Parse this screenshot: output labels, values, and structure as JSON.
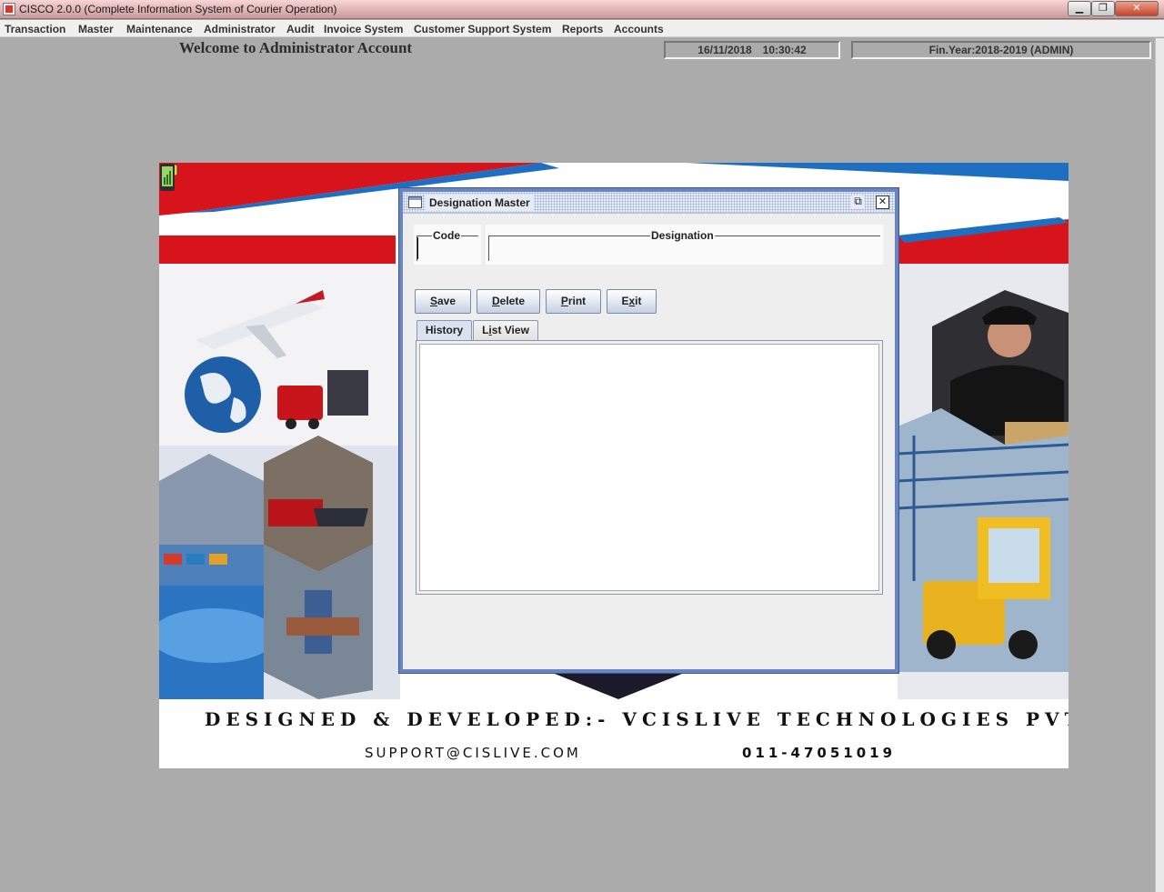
{
  "window": {
    "title": "CISCO 2.0.0 (Complete Information System of Courier Operation)",
    "minimize": "▁",
    "maximize": "❐",
    "close": "✕"
  },
  "menu": [
    "Transaction",
    "Master",
    "Maintenance",
    "Administrator",
    "Audit",
    "Invoice System",
    "Customer Support System",
    "Reports",
    "Accounts"
  ],
  "header": {
    "welcome": "Welcome to Administrator Account",
    "date": "16/11/2018",
    "time": "10:30:42",
    "fin_year": "Fin.Year:2018-2019  (ADMIN)"
  },
  "banner": {
    "designed_by": "DESIGNED & DEVELOPED:- VCISLIVE TECHNOLOGIES PVT LTD",
    "email": "SUPPORT@CISLIVE.COM",
    "phone": "011-47051019"
  },
  "dialog": {
    "title": "Designation Master",
    "restore_icon": "⧉",
    "close_icon": "✕",
    "fields": {
      "code_label": "Code",
      "code_value": "",
      "designation_label": "Designation",
      "designation_value": ""
    },
    "buttons": {
      "save_mnemonic": "S",
      "save_rest": "ave",
      "delete_mnemonic": "D",
      "delete_rest": "elete",
      "print_mnemonic": "P",
      "print_rest": "rint",
      "exit_pre": "E",
      "exit_mnemonic": "x",
      "exit_rest": "it"
    },
    "tabs": {
      "history": "History",
      "list_pre": "L",
      "list_mnemonic": "i",
      "list_rest": "st View"
    }
  },
  "colors": {
    "desktop": "#ababab",
    "frame_border": "#6a86c2",
    "banner_red": "#d7141c",
    "banner_blue": "#1e6fc2"
  }
}
